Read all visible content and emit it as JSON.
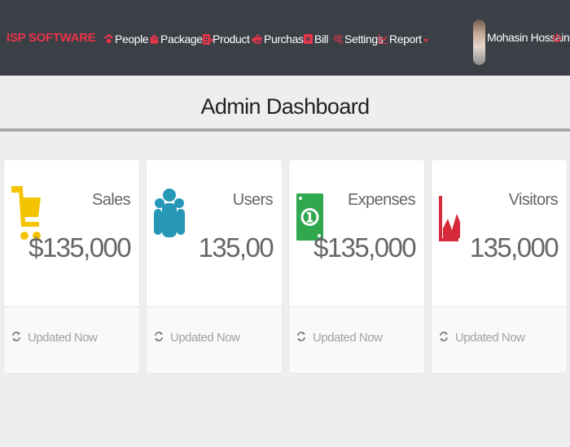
{
  "app": {
    "brand": "ISP SOFTWARE",
    "accent": "#e8344a",
    "nav_bg": "#3b3f46"
  },
  "nav": [
    {
      "label": "People",
      "icon": "paw-icon",
      "caret": true
    },
    {
      "label": "Packages",
      "icon": "users-icon",
      "caret": true
    },
    {
      "label": "Product",
      "icon": "document-icon",
      "caret": true
    },
    {
      "label": "Purchase",
      "icon": "shopping-basket-icon",
      "caret": false
    },
    {
      "label": "Bill",
      "icon": "money-icon",
      "caret": false
    },
    {
      "label": "Settings",
      "icon": "cogs-icon",
      "caret": false
    },
    {
      "label": "Report",
      "icon": "line-chart-icon",
      "caret": true
    }
  ],
  "user": {
    "name": "Mohasin Hossain",
    "logout_icon": "power-icon"
  },
  "page": {
    "title": "Admin Dashboard"
  },
  "cards": [
    {
      "label": "Sales",
      "value": "$135,000",
      "icon": "shopping-cart-icon",
      "color": "#f5c400",
      "footer": "Updated Now"
    },
    {
      "label": "Users",
      "value": "135,00",
      "icon": "users-icon",
      "color": "#2797b7",
      "footer": "Updated Now"
    },
    {
      "label": "Expenses",
      "value": "$135,000",
      "icon": "money-icon",
      "color": "#2fa84f",
      "footer": "Updated Now"
    },
    {
      "label": "Visitors",
      "value": "135,000",
      "icon": "area-chart-icon",
      "color": "#d62a3a",
      "footer": "Updated Now"
    }
  ]
}
